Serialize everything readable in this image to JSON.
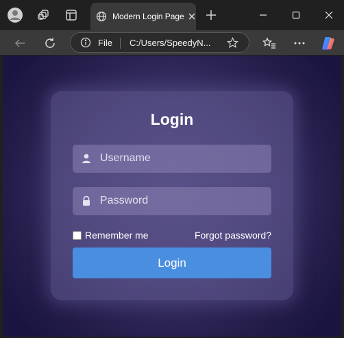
{
  "browser": {
    "tab": {
      "title": "Modern Login Page"
    },
    "address": {
      "scheme_label": "File",
      "url": "C:/Users/SpeedyN..."
    }
  },
  "login": {
    "title": "Login",
    "username": {
      "placeholder": "Username"
    },
    "password": {
      "placeholder": "Password"
    },
    "remember_label": "Remember me",
    "remember_checked": false,
    "forgot_label": "Forgot password?",
    "submit_label": "Login"
  },
  "colors": {
    "accent_button": "#4a8ee0",
    "background_dark": "#1a1540",
    "background_mid": "#3a3366",
    "chrome": "#202020"
  }
}
